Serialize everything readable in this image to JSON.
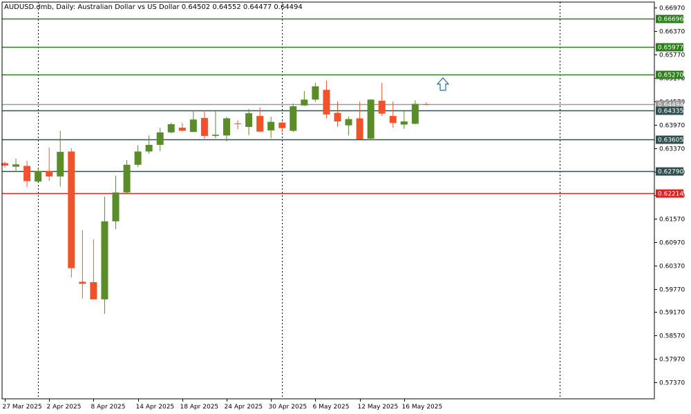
{
  "chart_data": {
    "type": "candlestick",
    "title": "AUDUSD.dmb, Daily:  Australian Dollar vs US Dollar  0.64502 0.64552 0.64477 0.64494",
    "y_ticks": [
      "0.66970",
      "0.66370",
      "0.65770",
      "0.65170",
      "0.64570",
      "0.63970",
      "0.63370",
      "0.62770",
      "0.62170",
      "0.61570",
      "0.60970",
      "0.60370",
      "0.59770",
      "0.59170",
      "0.58570",
      "0.57970",
      "0.57370"
    ],
    "y_tick_values": [
      0.6697,
      0.6637,
      0.6577,
      0.6517,
      0.6457,
      0.6397,
      0.6337,
      0.6277,
      0.6217,
      0.6157,
      0.6097,
      0.6037,
      0.5977,
      0.5917,
      0.5857,
      0.5797,
      0.5737
    ],
    "ylim": [
      0.5695,
      0.6712
    ],
    "x_ticks": [
      "27 Mar 2025",
      "2 Apr 2025",
      "8 Apr 2025",
      "14 Apr 2025",
      "18 Apr 2025",
      "24 Apr 2025",
      "30 Apr 2025",
      "6 May 2025",
      "12 May 2025",
      "16 May 2025"
    ],
    "x_tick_index": [
      0,
      4,
      8,
      12,
      16,
      20,
      24,
      28,
      32,
      36
    ],
    "separators": [
      3,
      25,
      50
    ],
    "colors": {
      "up": "#5b8c2a",
      "down": "#f0522c",
      "frame": "#000000",
      "grid": "#000000",
      "arrow": "#1e6aa8"
    },
    "candles": [
      {
        "o": 0.6299,
        "h": 0.6303,
        "l": 0.6288,
        "c": 0.6293
      },
      {
        "o": 0.629,
        "h": 0.6311,
        "l": 0.628,
        "c": 0.6296
      },
      {
        "o": 0.6292,
        "h": 0.6305,
        "l": 0.6238,
        "c": 0.6253
      },
      {
        "o": 0.6252,
        "h": 0.6288,
        "l": 0.625,
        "c": 0.6279
      },
      {
        "o": 0.6279,
        "h": 0.6339,
        "l": 0.6254,
        "c": 0.6265
      },
      {
        "o": 0.6265,
        "h": 0.6382,
        "l": 0.6239,
        "c": 0.6328
      },
      {
        "o": 0.6329,
        "h": 0.6337,
        "l": 0.6006,
        "c": 0.603
      },
      {
        "o": 0.5995,
        "h": 0.6127,
        "l": 0.5952,
        "c": 0.599
      },
      {
        "o": 0.5994,
        "h": 0.6104,
        "l": 0.5952,
        "c": 0.595
      },
      {
        "o": 0.595,
        "h": 0.6213,
        "l": 0.5913,
        "c": 0.615
      },
      {
        "o": 0.615,
        "h": 0.6267,
        "l": 0.613,
        "c": 0.6224
      },
      {
        "o": 0.6224,
        "h": 0.6307,
        "l": 0.6222,
        "c": 0.6295
      },
      {
        "o": 0.6295,
        "h": 0.6345,
        "l": 0.6289,
        "c": 0.6329
      },
      {
        "o": 0.6329,
        "h": 0.637,
        "l": 0.6323,
        "c": 0.6346
      },
      {
        "o": 0.6346,
        "h": 0.639,
        "l": 0.633,
        "c": 0.6378
      },
      {
        "o": 0.6378,
        "h": 0.6403,
        "l": 0.6375,
        "c": 0.6399
      },
      {
        "o": 0.639,
        "h": 0.6402,
        "l": 0.6381,
        "c": 0.6382
      },
      {
        "o": 0.6379,
        "h": 0.6434,
        "l": 0.6379,
        "c": 0.6411
      },
      {
        "o": 0.6415,
        "h": 0.6434,
        "l": 0.6362,
        "c": 0.6369
      },
      {
        "o": 0.6369,
        "h": 0.6433,
        "l": 0.6363,
        "c": 0.6372
      },
      {
        "o": 0.637,
        "h": 0.6418,
        "l": 0.6355,
        "c": 0.6414
      },
      {
        "o": 0.6401,
        "h": 0.6409,
        "l": 0.6386,
        "c": 0.64
      },
      {
        "o": 0.6392,
        "h": 0.6438,
        "l": 0.6371,
        "c": 0.6427
      },
      {
        "o": 0.642,
        "h": 0.6442,
        "l": 0.6379,
        "c": 0.638
      },
      {
        "o": 0.6383,
        "h": 0.6418,
        "l": 0.6363,
        "c": 0.6405
      },
      {
        "o": 0.6403,
        "h": 0.6407,
        "l": 0.6378,
        "c": 0.6389
      },
      {
        "o": 0.6382,
        "h": 0.6452,
        "l": 0.6379,
        "c": 0.6445
      },
      {
        "o": 0.6447,
        "h": 0.6484,
        "l": 0.6446,
        "c": 0.6462
      },
      {
        "o": 0.6462,
        "h": 0.6505,
        "l": 0.6456,
        "c": 0.6496
      },
      {
        "o": 0.6487,
        "h": 0.6511,
        "l": 0.6414,
        "c": 0.6424
      },
      {
        "o": 0.6428,
        "h": 0.6457,
        "l": 0.6393,
        "c": 0.6406
      },
      {
        "o": 0.6396,
        "h": 0.6419,
        "l": 0.637,
        "c": 0.6412
      },
      {
        "o": 0.6414,
        "h": 0.6457,
        "l": 0.636,
        "c": 0.636
      },
      {
        "o": 0.6362,
        "h": 0.6463,
        "l": 0.6359,
        "c": 0.6462
      },
      {
        "o": 0.6459,
        "h": 0.6505,
        "l": 0.642,
        "c": 0.6426
      },
      {
        "o": 0.642,
        "h": 0.6457,
        "l": 0.639,
        "c": 0.6402
      },
      {
        "o": 0.6398,
        "h": 0.6433,
        "l": 0.6387,
        "c": 0.6406
      },
      {
        "o": 0.64,
        "h": 0.646,
        "l": 0.6399,
        "c": 0.6451
      },
      {
        "o": 0.64502,
        "h": 0.64552,
        "l": 0.64477,
        "c": 0.64494
      }
    ],
    "levels": [
      {
        "value": 0.66696,
        "label": "0.66696",
        "color": "#2e7d1e",
        "tag": "#2e7d1e",
        "style": "solid"
      },
      {
        "value": 0.65977,
        "label": "0.65977",
        "color": "#2e7d1e",
        "tag": "#2e7d1e",
        "style": "solid"
      },
      {
        "value": 0.6527,
        "label": "0.65270",
        "color": "#2e7d1e",
        "tag": "#2e7d1e",
        "style": "solid"
      },
      {
        "value": 0.64494,
        "label": "0.64494",
        "color": "#9a9a9a",
        "tag": "#9a9a9a",
        "style": "solid"
      },
      {
        "value": 0.64335,
        "label": "0.64335",
        "color": "#2f4f4f",
        "tag": "#2f4f4f",
        "style": "solid"
      },
      {
        "value": 0.63605,
        "label": "0.63605",
        "color": "#2f4f4f",
        "tag": "#2f4f4f",
        "style": "solid"
      },
      {
        "value": 0.6279,
        "label": "0.62790",
        "color": "#2f4f4f",
        "tag": "#2f4f4f",
        "style": "solid"
      },
      {
        "value": 0.62214,
        "label": "0.62214",
        "color": "#e02020",
        "tag": "#e02020",
        "style": "solid"
      }
    ],
    "arrow_price": 0.65
  }
}
